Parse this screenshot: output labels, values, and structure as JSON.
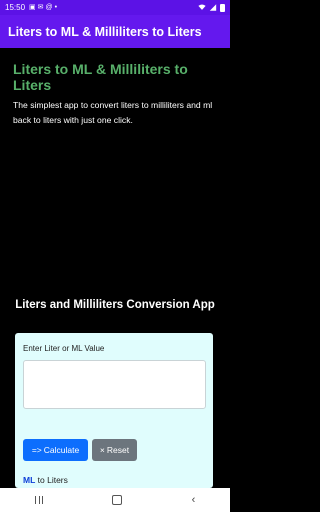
{
  "status_bar": {
    "time": "15:50",
    "icons": [
      "image-icon",
      "email-icon",
      "at-icon",
      "dot-icon",
      "wifi-icon",
      "signal-icon",
      "battery-icon"
    ]
  },
  "app_bar": {
    "title": "Liters to ML & Milliliters to Liters"
  },
  "intro": {
    "title": "Liters to ML & Milliliters to Liters",
    "description": "The simplest app to convert liters to milliliters and ml back to liters with just one click."
  },
  "converter": {
    "heading": "Liters and Milliliters Conversion App",
    "input_label": "Enter Liter or ML Value",
    "input_value": "",
    "calculate_label": "Calculate",
    "calculate_prefix": "=>",
    "reset_label": "Reset",
    "reset_prefix": "×",
    "result_unit": "ML",
    "result_rest": " to Liters"
  },
  "colors": {
    "status_bar": "#5c12e6",
    "app_bar": "#6418ee",
    "intro_title": "#58b06a",
    "panel": "#e0fdfd",
    "calculate": "#0d6efd",
    "reset": "#6c757d"
  }
}
